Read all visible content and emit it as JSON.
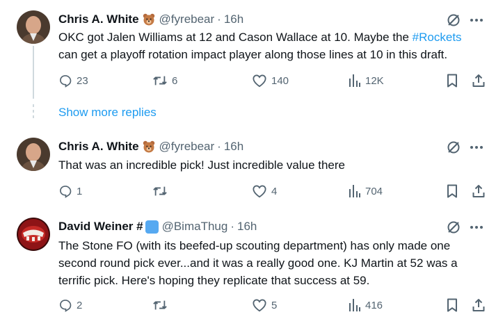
{
  "tweets": [
    {
      "name": "Chris A. White",
      "emoji_icon": "teddy-bear-emoji",
      "handle": "@fyrebear",
      "dot": "·",
      "time": "16h",
      "text_before": "OKC got Jalen Williams at 12 and Cason Wallace at 10. Maybe the ",
      "hashtag": "#Rockets",
      "text_line2": "can get a playoff rotation impact player along those lines at 10 in this draft.",
      "replies": "23",
      "reposts": "6",
      "likes": "140",
      "views": "12K"
    },
    {
      "name": "Chris A. White",
      "emoji_icon": "teddy-bear-emoji",
      "handle": "@fyrebear",
      "dot": "·",
      "time": "16h",
      "text_line1": "That was an incredible pick! Just incredible value there",
      "replies": "1",
      "reposts": "",
      "likes": "4",
      "views": "704"
    },
    {
      "name": "David Weiner #",
      "badge_icon": "blue-square-emoji",
      "handle": "@BimaThug",
      "dot": "·",
      "time": "16h",
      "text_line1": "The Stone FO (with its beefed-up scouting department) has only made one",
      "text_line2": "second round pick ever...and it was a really good one. KJ Martin at 52 was a",
      "text_line3": "terrific pick. Here's hoping they replicate that success at 59.",
      "replies": "2",
      "reposts": "",
      "likes": "5",
      "views": "416"
    }
  ],
  "show_more_replies": "Show more replies",
  "colors": {
    "accent": "#1d9bf0",
    "muted": "#536471",
    "text": "#0f1419",
    "thread": "#cfd9de"
  },
  "icons": [
    "reply-icon",
    "repost-icon",
    "like-icon",
    "views-icon",
    "bookmark-icon",
    "share-icon",
    "grok-icon",
    "more-icon"
  ]
}
